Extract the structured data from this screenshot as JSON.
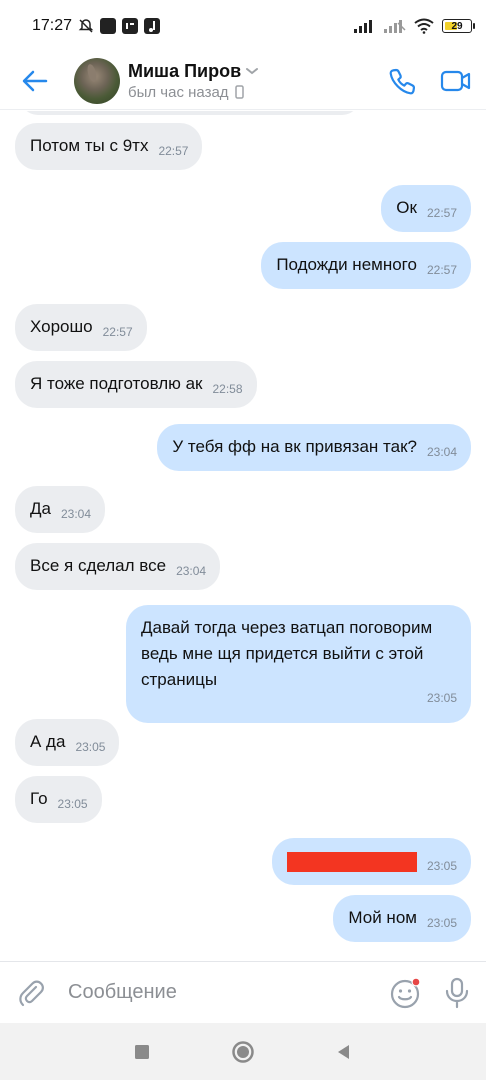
{
  "status_bar": {
    "time": "17:27",
    "battery": "29"
  },
  "header": {
    "name": "Миша Пиров",
    "status": "был час назад",
    "colors": {
      "accent": "#2688eb"
    }
  },
  "messages": [
    {
      "dir": "in",
      "text": "Потом ты с 9тх",
      "time": "22:57"
    },
    {
      "dir": "out",
      "text": "Ок",
      "time": "22:57"
    },
    {
      "dir": "out",
      "text": "Подожди немного",
      "time": "22:57"
    },
    {
      "dir": "in",
      "text": "Хорошо",
      "time": "22:57"
    },
    {
      "dir": "in",
      "text": "Я тоже подготовлю ак",
      "time": "22:58"
    },
    {
      "dir": "out",
      "text": "У тебя фф на вк привязан так?",
      "time": "23:04"
    },
    {
      "dir": "in",
      "text": "Да",
      "time": "23:04"
    },
    {
      "dir": "in",
      "text": "Все я сделал все",
      "time": "23:04"
    },
    {
      "dir": "out",
      "text": "Давай тогда через ватцап поговорим ведь мне щя придется выйти с этой страницы",
      "time": "23:05"
    },
    {
      "dir": "in",
      "text": "А да",
      "time": "23:05"
    },
    {
      "dir": "in",
      "text": "Го",
      "time": "23:05"
    },
    {
      "dir": "out",
      "text": "",
      "redacted": true,
      "time": "23:05"
    },
    {
      "dir": "out",
      "text": "Мой ном",
      "time": "23:05"
    }
  ],
  "composer": {
    "placeholder": "Сообщение"
  },
  "icons": {
    "back": "back-arrow-icon",
    "call": "phone-icon",
    "video": "video-call-icon",
    "attach": "paperclip-icon",
    "emoji": "emoji-icon",
    "mic": "microphone-icon"
  },
  "colors": {
    "incoming_bubble": "#ebedf0",
    "outgoing_bubble": "#cce4ff",
    "timestamp": "#818c99",
    "redaction": "#f33521"
  }
}
